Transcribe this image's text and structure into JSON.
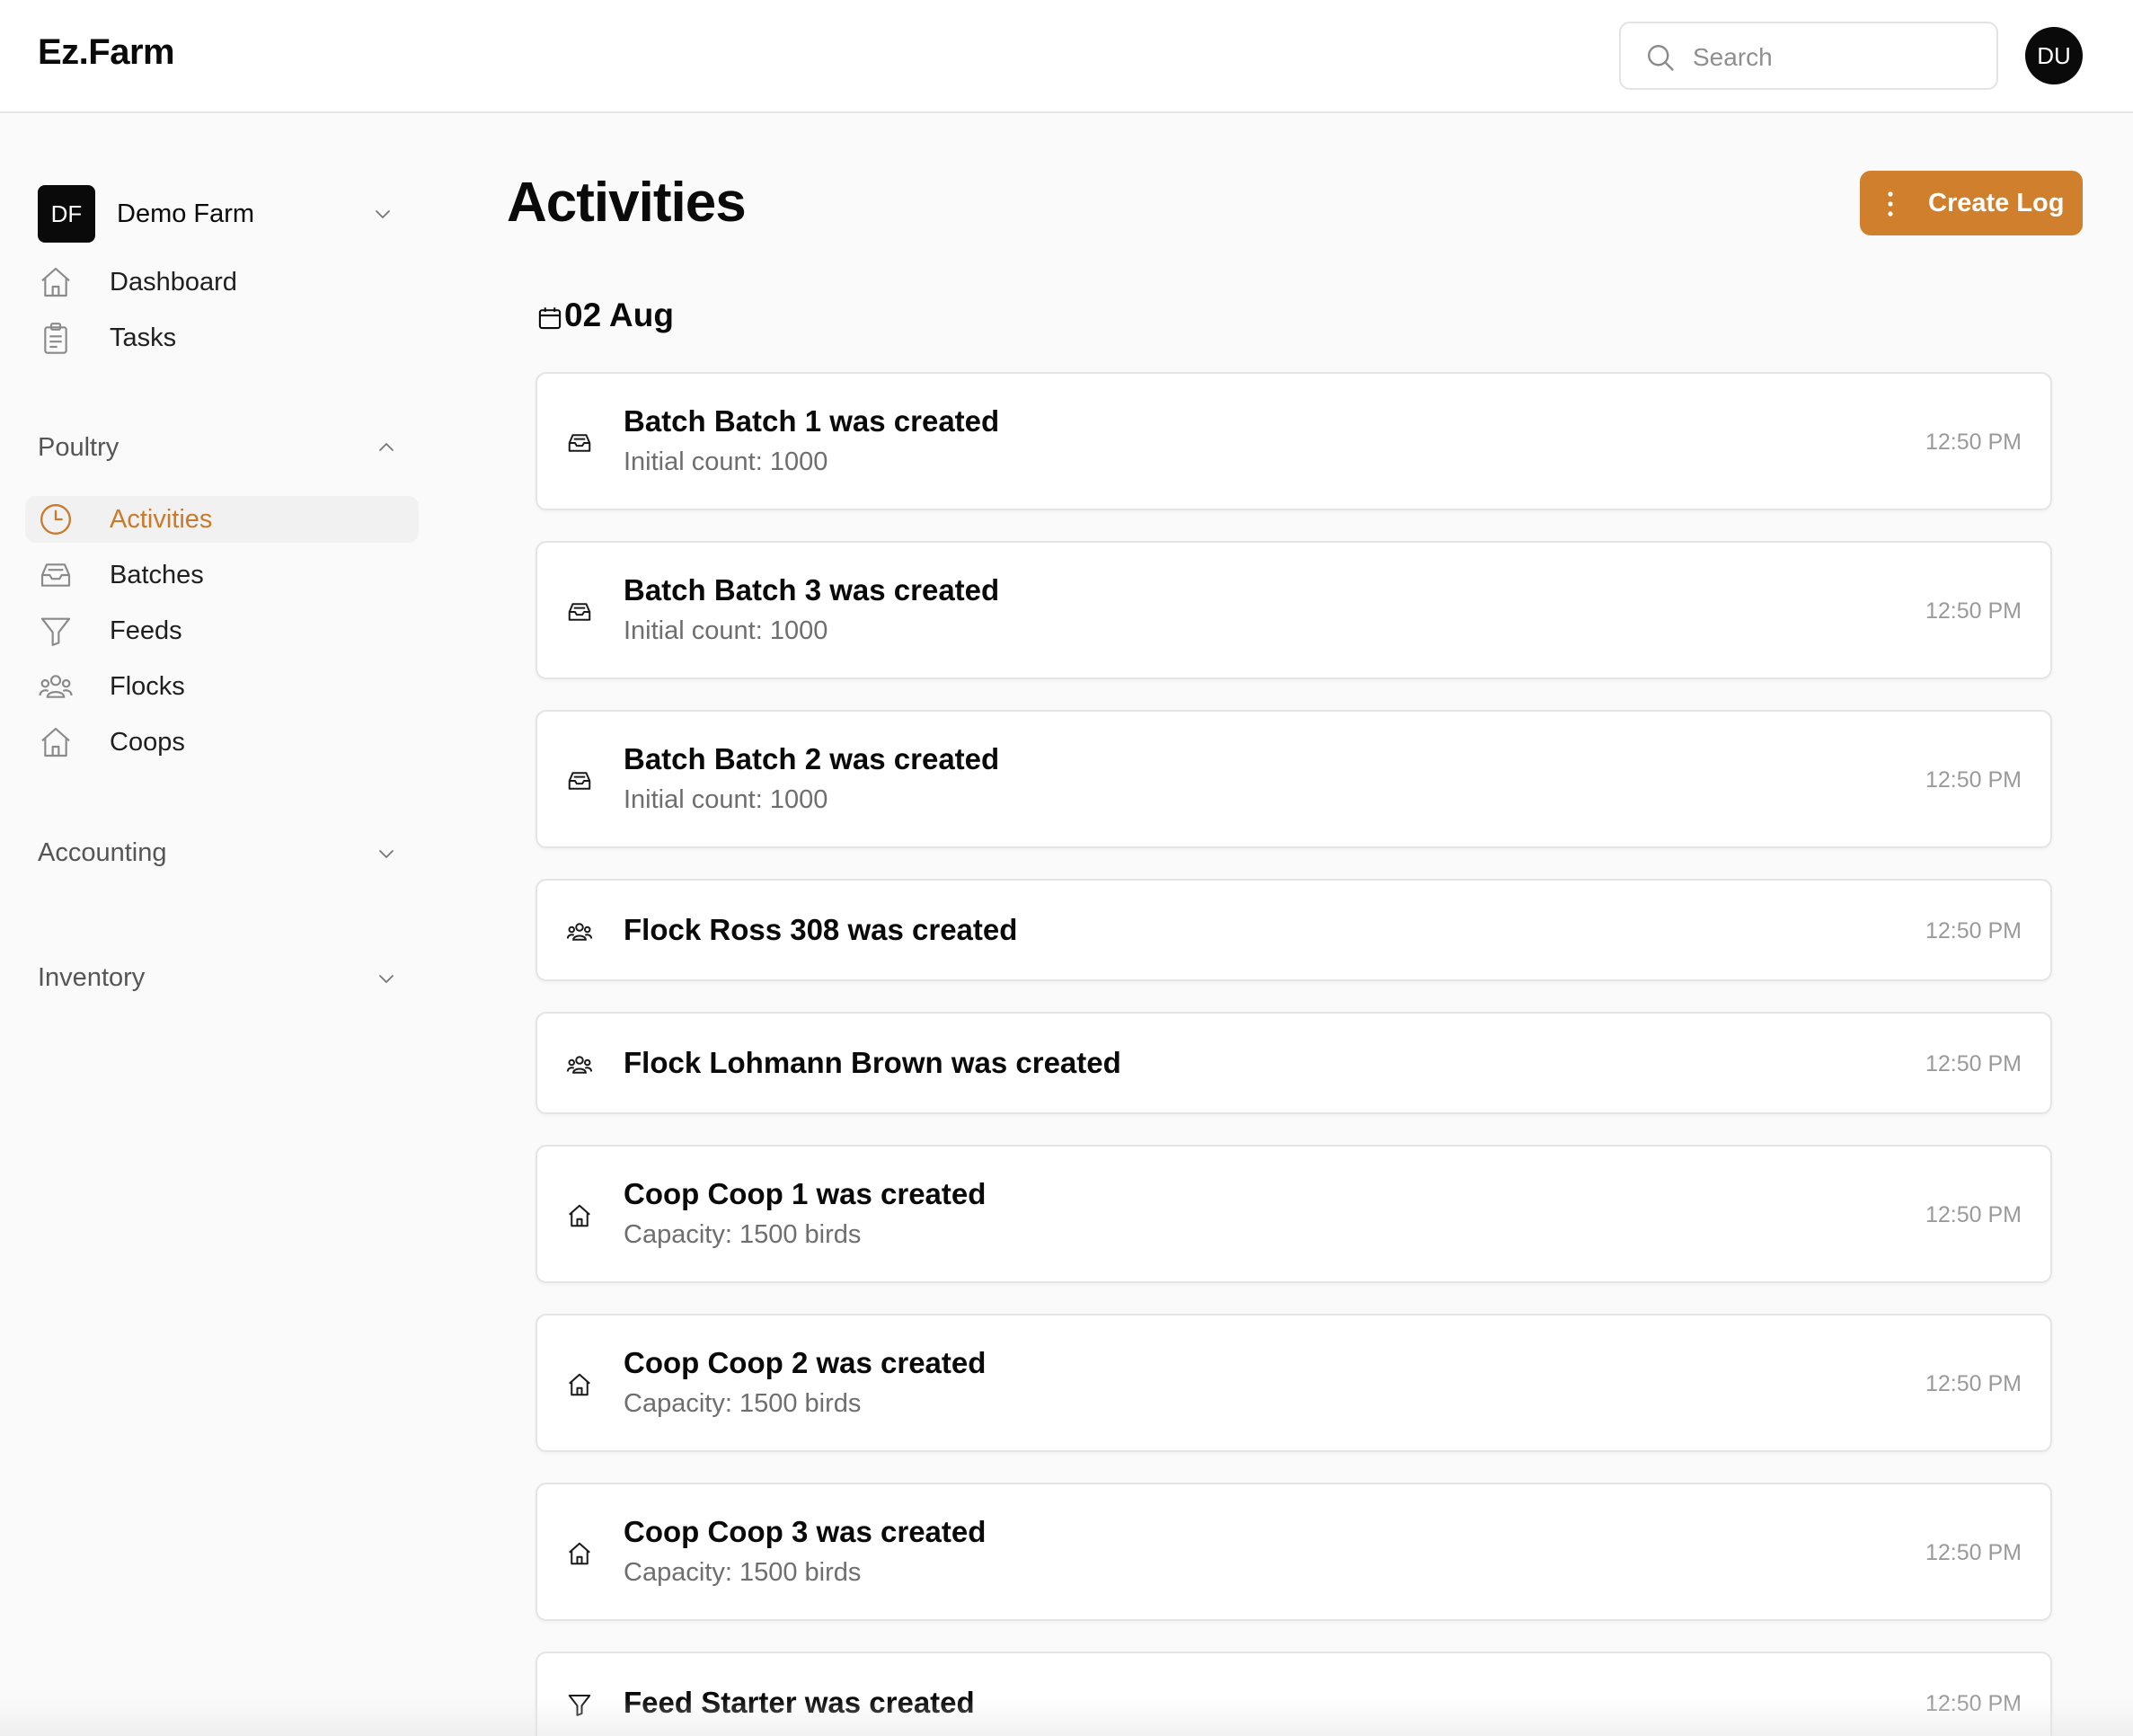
{
  "header": {
    "logo": "Ez.Farm",
    "search_placeholder": "Search",
    "search_icon": "search-icon",
    "avatar_initials": "DU"
  },
  "sidebar": {
    "farm": {
      "initials": "DF",
      "name": "Demo Farm"
    },
    "top_items": [
      {
        "label": "Dashboard",
        "icon": "home-icon"
      },
      {
        "label": "Tasks",
        "icon": "clipboard-icon"
      }
    ],
    "sections": [
      {
        "title": "Poultry",
        "expanded": true,
        "items": [
          {
            "label": "Activities",
            "icon": "clock-icon",
            "active": true
          },
          {
            "label": "Batches",
            "icon": "inbox-icon"
          },
          {
            "label": "Feeds",
            "icon": "funnel-icon"
          },
          {
            "label": "Flocks",
            "icon": "users-icon"
          },
          {
            "label": "Coops",
            "icon": "home-icon"
          }
        ]
      },
      {
        "title": "Accounting",
        "expanded": false
      },
      {
        "title": "Inventory",
        "expanded": false
      }
    ]
  },
  "main": {
    "title": "Activities",
    "create_button": "Create Log",
    "date_heading": "02 Aug",
    "activities": [
      {
        "title": "Batch Batch 1 was created",
        "subtitle": "Initial count: 1000",
        "time": "12:50 PM",
        "icon": "inbox-icon"
      },
      {
        "title": "Batch Batch 3 was created",
        "subtitle": "Initial count: 1000",
        "time": "12:50 PM",
        "icon": "inbox-icon"
      },
      {
        "title": "Batch Batch 2 was created",
        "subtitle": "Initial count: 1000",
        "time": "12:50 PM",
        "icon": "inbox-icon"
      },
      {
        "title": "Flock Ross 308 was created",
        "subtitle": "",
        "time": "12:50 PM",
        "icon": "users-icon"
      },
      {
        "title": "Flock Lohmann Brown was created",
        "subtitle": "",
        "time": "12:50 PM",
        "icon": "users-icon"
      },
      {
        "title": "Coop Coop 1 was created",
        "subtitle": "Capacity: 1500 birds",
        "time": "12:50 PM",
        "icon": "home-icon"
      },
      {
        "title": "Coop Coop 2 was created",
        "subtitle": "Capacity: 1500 birds",
        "time": "12:50 PM",
        "icon": "home-icon"
      },
      {
        "title": "Coop Coop 3 was created",
        "subtitle": "Capacity: 1500 birds",
        "time": "12:50 PM",
        "icon": "home-icon"
      },
      {
        "title": "Feed Starter was created",
        "subtitle": "",
        "time": "12:50 PM",
        "icon": "funnel-icon"
      }
    ]
  },
  "colors": {
    "accent": "#d07f2c",
    "active_text": "#c97a2b",
    "dark": "#0a0a0a"
  }
}
